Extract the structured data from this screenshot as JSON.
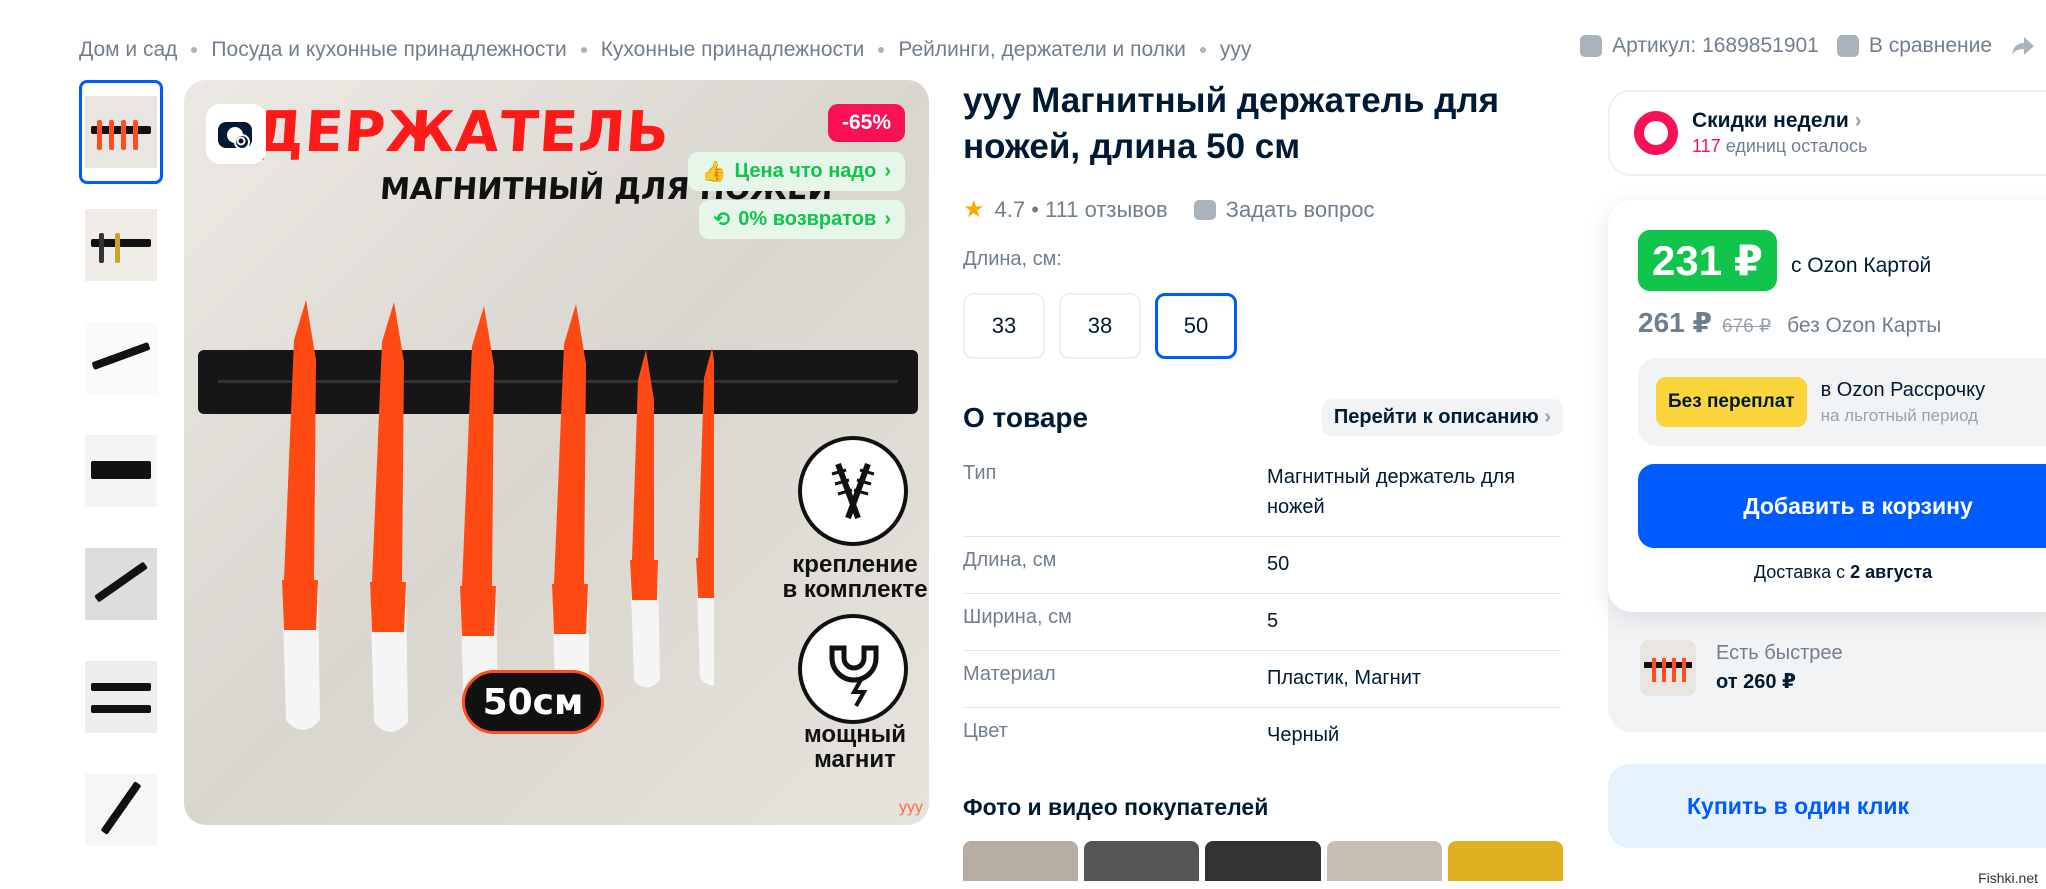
{
  "breadcrumb": [
    "Дом и сад",
    "Посуда и кухонные принадлежности",
    "Кухонные принадлежности",
    "Рейлинги, держатели и полки",
    "ууу"
  ],
  "top_right": {
    "article": "Артикул: 1689851901",
    "compare": "В сравнение"
  },
  "image": {
    "title_text": "ДЕРЖАТЕЛЬ",
    "subtitle_text": "МАГНИТНЫЙ ДЛЯ НОЖЕЙ",
    "discount": "-65%",
    "badge_price": "Цена что надо",
    "badge_returns": "0% возвратов",
    "feature1": "крепление в комплекте",
    "feature2": "мощный магнит",
    "size_label": "50см",
    "watermark": "ууу"
  },
  "product": {
    "title": "ууу Магнитный держатель для ножей, длина 50 см",
    "rating": "4.7 • 111 отзывов",
    "ask": "Задать вопрос",
    "length_label": "Длина, см:",
    "sizes": [
      "33",
      "38",
      "50"
    ],
    "selected_size": "50",
    "about_title": "О товаре",
    "goto_desc": "Перейти к описанию",
    "specs": [
      {
        "k": "Тип",
        "v": "Магнитный держатель для ножей"
      },
      {
        "k": "Длина, см",
        "v": "50"
      },
      {
        "k": "Ширина, см",
        "v": "5"
      },
      {
        "k": "Материал",
        "v": "Пластик, Магнит"
      },
      {
        "k": "Цвет",
        "v": "Черный"
      }
    ],
    "photos_title": "Фото и видео покупателей"
  },
  "promo": {
    "title": "Скидки недели",
    "count": "117",
    "count_suffix": " единиц осталось"
  },
  "buy": {
    "price_card": "231 ₽",
    "with_card": "с Ozon Картой",
    "price": "261 ₽",
    "old_price": "676 ₽",
    "without_card": "без Ozon Карты",
    "installment_tag": "Без переплат",
    "installment_a": "в Ozon Рассрочку",
    "installment_b": "на льготный период",
    "add_to_cart": "Добавить в корзину",
    "delivery_prefix": "Доставка с ",
    "delivery_date": "2 августа",
    "faster_a": "Есть быстрее",
    "faster_b": "от 260 ₽",
    "one_click": "Купить в один клик"
  },
  "footer_watermark": "Fishki.net",
  "colors": {
    "accent": "#005bff",
    "green": "#10c44c",
    "pink": "#f91155",
    "yellow": "#fcd43b"
  }
}
